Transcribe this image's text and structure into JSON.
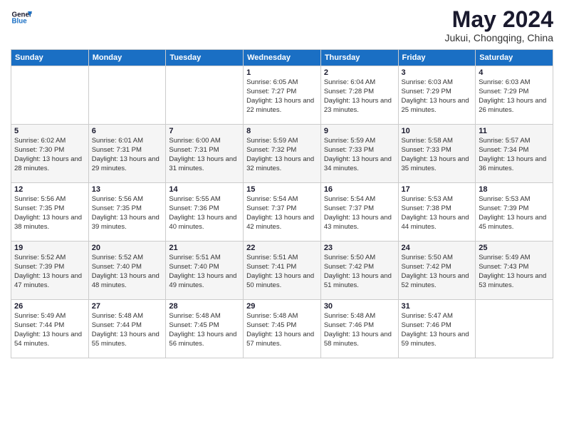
{
  "header": {
    "logo_general": "General",
    "logo_blue": "Blue",
    "month": "May 2024",
    "location": "Jukui, Chongqing, China"
  },
  "days_of_week": [
    "Sunday",
    "Monday",
    "Tuesday",
    "Wednesday",
    "Thursday",
    "Friday",
    "Saturday"
  ],
  "weeks": [
    [
      {
        "day": "",
        "info": ""
      },
      {
        "day": "",
        "info": ""
      },
      {
        "day": "",
        "info": ""
      },
      {
        "day": "1",
        "info": "Sunrise: 6:05 AM\nSunset: 7:27 PM\nDaylight: 13 hours and 22 minutes."
      },
      {
        "day": "2",
        "info": "Sunrise: 6:04 AM\nSunset: 7:28 PM\nDaylight: 13 hours and 23 minutes."
      },
      {
        "day": "3",
        "info": "Sunrise: 6:03 AM\nSunset: 7:29 PM\nDaylight: 13 hours and 25 minutes."
      },
      {
        "day": "4",
        "info": "Sunrise: 6:03 AM\nSunset: 7:29 PM\nDaylight: 13 hours and 26 minutes."
      }
    ],
    [
      {
        "day": "5",
        "info": "Sunrise: 6:02 AM\nSunset: 7:30 PM\nDaylight: 13 hours and 28 minutes."
      },
      {
        "day": "6",
        "info": "Sunrise: 6:01 AM\nSunset: 7:31 PM\nDaylight: 13 hours and 29 minutes."
      },
      {
        "day": "7",
        "info": "Sunrise: 6:00 AM\nSunset: 7:31 PM\nDaylight: 13 hours and 31 minutes."
      },
      {
        "day": "8",
        "info": "Sunrise: 5:59 AM\nSunset: 7:32 PM\nDaylight: 13 hours and 32 minutes."
      },
      {
        "day": "9",
        "info": "Sunrise: 5:59 AM\nSunset: 7:33 PM\nDaylight: 13 hours and 34 minutes."
      },
      {
        "day": "10",
        "info": "Sunrise: 5:58 AM\nSunset: 7:33 PM\nDaylight: 13 hours and 35 minutes."
      },
      {
        "day": "11",
        "info": "Sunrise: 5:57 AM\nSunset: 7:34 PM\nDaylight: 13 hours and 36 minutes."
      }
    ],
    [
      {
        "day": "12",
        "info": "Sunrise: 5:56 AM\nSunset: 7:35 PM\nDaylight: 13 hours and 38 minutes."
      },
      {
        "day": "13",
        "info": "Sunrise: 5:56 AM\nSunset: 7:35 PM\nDaylight: 13 hours and 39 minutes."
      },
      {
        "day": "14",
        "info": "Sunrise: 5:55 AM\nSunset: 7:36 PM\nDaylight: 13 hours and 40 minutes."
      },
      {
        "day": "15",
        "info": "Sunrise: 5:54 AM\nSunset: 7:37 PM\nDaylight: 13 hours and 42 minutes."
      },
      {
        "day": "16",
        "info": "Sunrise: 5:54 AM\nSunset: 7:37 PM\nDaylight: 13 hours and 43 minutes."
      },
      {
        "day": "17",
        "info": "Sunrise: 5:53 AM\nSunset: 7:38 PM\nDaylight: 13 hours and 44 minutes."
      },
      {
        "day": "18",
        "info": "Sunrise: 5:53 AM\nSunset: 7:39 PM\nDaylight: 13 hours and 45 minutes."
      }
    ],
    [
      {
        "day": "19",
        "info": "Sunrise: 5:52 AM\nSunset: 7:39 PM\nDaylight: 13 hours and 47 minutes."
      },
      {
        "day": "20",
        "info": "Sunrise: 5:52 AM\nSunset: 7:40 PM\nDaylight: 13 hours and 48 minutes."
      },
      {
        "day": "21",
        "info": "Sunrise: 5:51 AM\nSunset: 7:40 PM\nDaylight: 13 hours and 49 minutes."
      },
      {
        "day": "22",
        "info": "Sunrise: 5:51 AM\nSunset: 7:41 PM\nDaylight: 13 hours and 50 minutes."
      },
      {
        "day": "23",
        "info": "Sunrise: 5:50 AM\nSunset: 7:42 PM\nDaylight: 13 hours and 51 minutes."
      },
      {
        "day": "24",
        "info": "Sunrise: 5:50 AM\nSunset: 7:42 PM\nDaylight: 13 hours and 52 minutes."
      },
      {
        "day": "25",
        "info": "Sunrise: 5:49 AM\nSunset: 7:43 PM\nDaylight: 13 hours and 53 minutes."
      }
    ],
    [
      {
        "day": "26",
        "info": "Sunrise: 5:49 AM\nSunset: 7:44 PM\nDaylight: 13 hours and 54 minutes."
      },
      {
        "day": "27",
        "info": "Sunrise: 5:48 AM\nSunset: 7:44 PM\nDaylight: 13 hours and 55 minutes."
      },
      {
        "day": "28",
        "info": "Sunrise: 5:48 AM\nSunset: 7:45 PM\nDaylight: 13 hours and 56 minutes."
      },
      {
        "day": "29",
        "info": "Sunrise: 5:48 AM\nSunset: 7:45 PM\nDaylight: 13 hours and 57 minutes."
      },
      {
        "day": "30",
        "info": "Sunrise: 5:48 AM\nSunset: 7:46 PM\nDaylight: 13 hours and 58 minutes."
      },
      {
        "day": "31",
        "info": "Sunrise: 5:47 AM\nSunset: 7:46 PM\nDaylight: 13 hours and 59 minutes."
      },
      {
        "day": "",
        "info": ""
      }
    ]
  ]
}
